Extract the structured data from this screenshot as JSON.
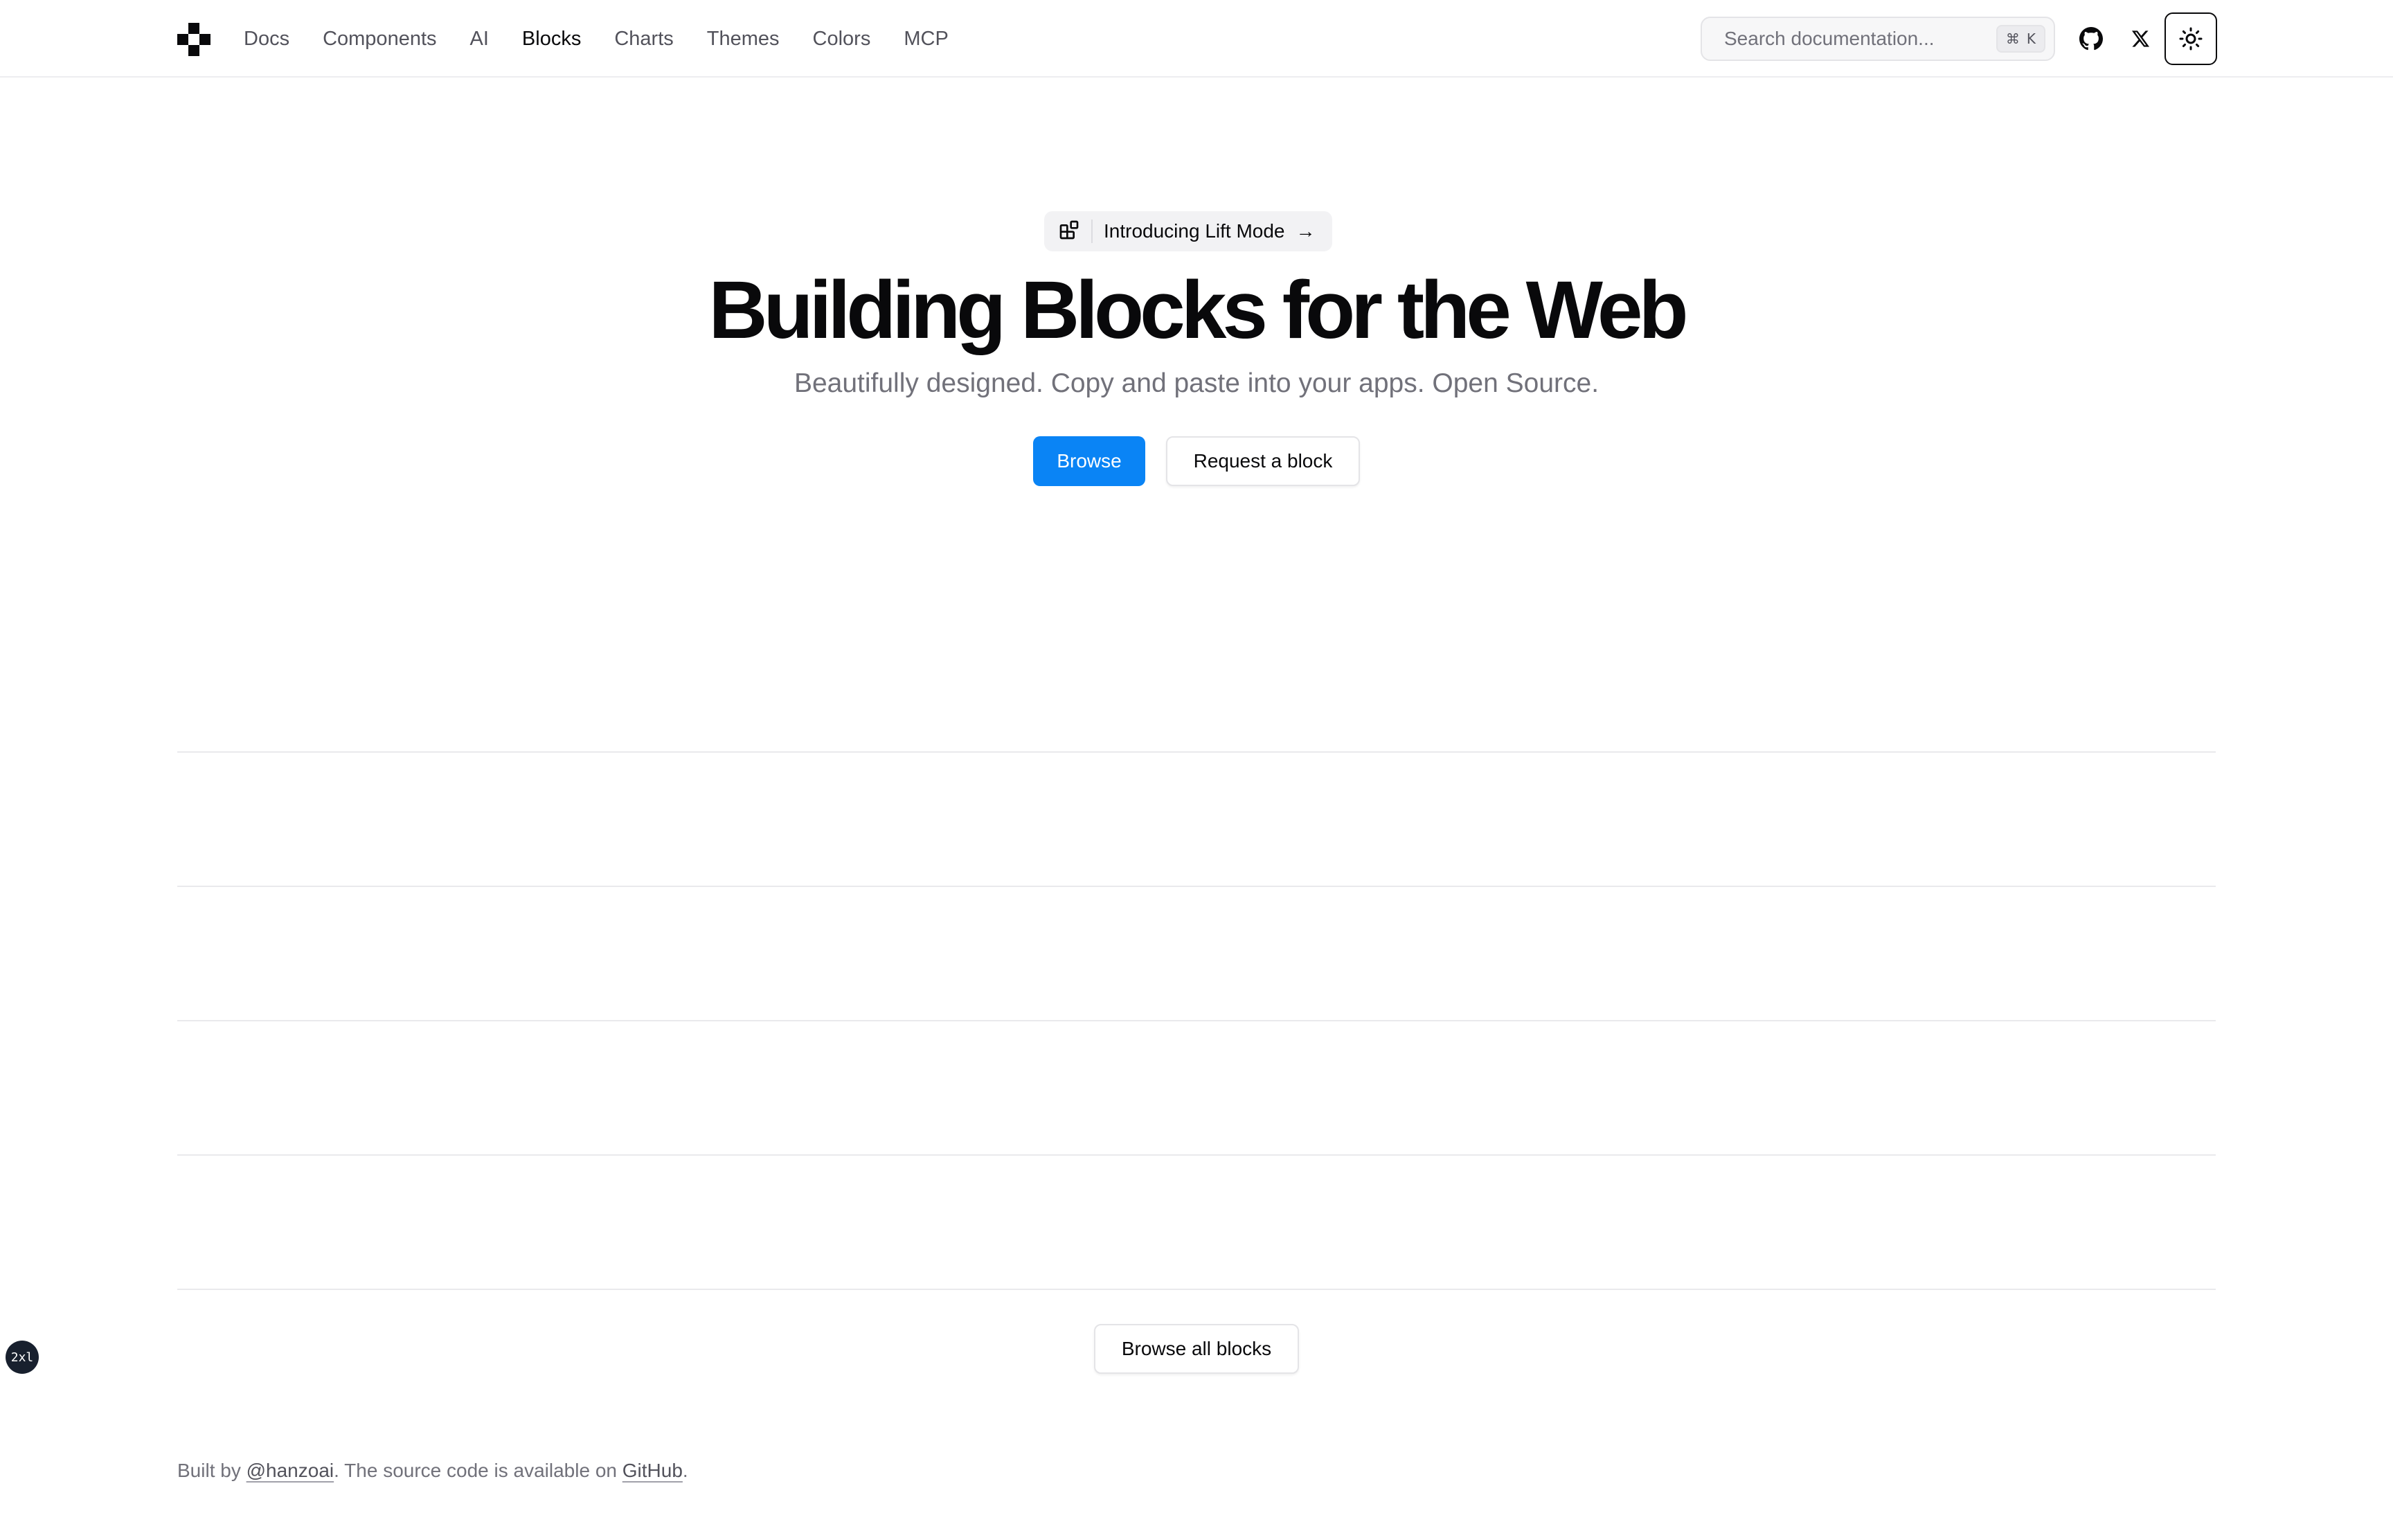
{
  "header": {
    "nav": [
      {
        "label": "Docs",
        "active": false
      },
      {
        "label": "Components",
        "active": false
      },
      {
        "label": "AI",
        "active": false
      },
      {
        "label": "Blocks",
        "active": true
      },
      {
        "label": "Charts",
        "active": false
      },
      {
        "label": "Themes",
        "active": false
      },
      {
        "label": "Colors",
        "active": false
      },
      {
        "label": "MCP",
        "active": false
      }
    ],
    "search": {
      "placeholder": "Search documentation...",
      "shortcut_symbol": "⌘",
      "shortcut_key": "K"
    },
    "icons": {
      "logo": "logo-icon",
      "github": "github-icon",
      "x": "x-icon",
      "theme": "sun-icon"
    }
  },
  "hero": {
    "announcement": "Introducing Lift Mode",
    "announcement_icon": "blocks-icon",
    "announcement_arrow": "→",
    "title": "Building Blocks for the Web",
    "subtitle": "Beautifully designed. Copy and paste into your apps. Open Source.",
    "primary_button": "Browse",
    "secondary_button": "Request a block"
  },
  "blocks": {
    "browse_all_button": "Browse all blocks"
  },
  "breakpoint_indicator": "2xl",
  "footer": {
    "prefix": "Built by ",
    "author_link": "@hanzoai",
    "middle": ". The source code is available on ",
    "source_link": "GitHub",
    "suffix": "."
  },
  "colors": {
    "accent": "#0a84f5",
    "text": "#09090b",
    "muted": "#71717a"
  }
}
